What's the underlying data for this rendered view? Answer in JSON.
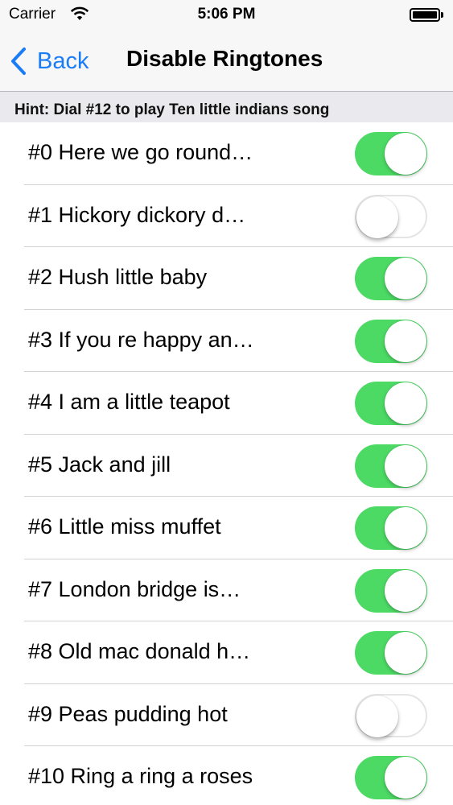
{
  "status_bar": {
    "carrier": "Carrier",
    "time": "5:06 PM",
    "wifi_icon": "wifi-icon",
    "battery_icon": "battery-icon"
  },
  "nav": {
    "back_label": "Back",
    "title": "Disable Ringtones"
  },
  "hint": "Hint: Dial #12 to play Ten little indians song",
  "colors": {
    "accent": "#1a7cf6",
    "toggle_on": "#4cd964"
  },
  "ringtones": [
    {
      "label": "#0 Here we go round…",
      "enabled": true
    },
    {
      "label": "#1 Hickory dickory d…",
      "enabled": false
    },
    {
      "label": "#2 Hush little baby",
      "enabled": true
    },
    {
      "label": "#3 If you re happy an…",
      "enabled": true
    },
    {
      "label": "#4 I am a little teapot",
      "enabled": true
    },
    {
      "label": "#5 Jack and jill",
      "enabled": true
    },
    {
      "label": "#6 Little miss muffet",
      "enabled": true
    },
    {
      "label": "#7 London bridge is…",
      "enabled": true
    },
    {
      "label": "#8 Old mac donald h…",
      "enabled": true
    },
    {
      "label": "#9 Peas pudding hot",
      "enabled": false
    },
    {
      "label": "#10 Ring a ring a roses",
      "enabled": true
    }
  ]
}
